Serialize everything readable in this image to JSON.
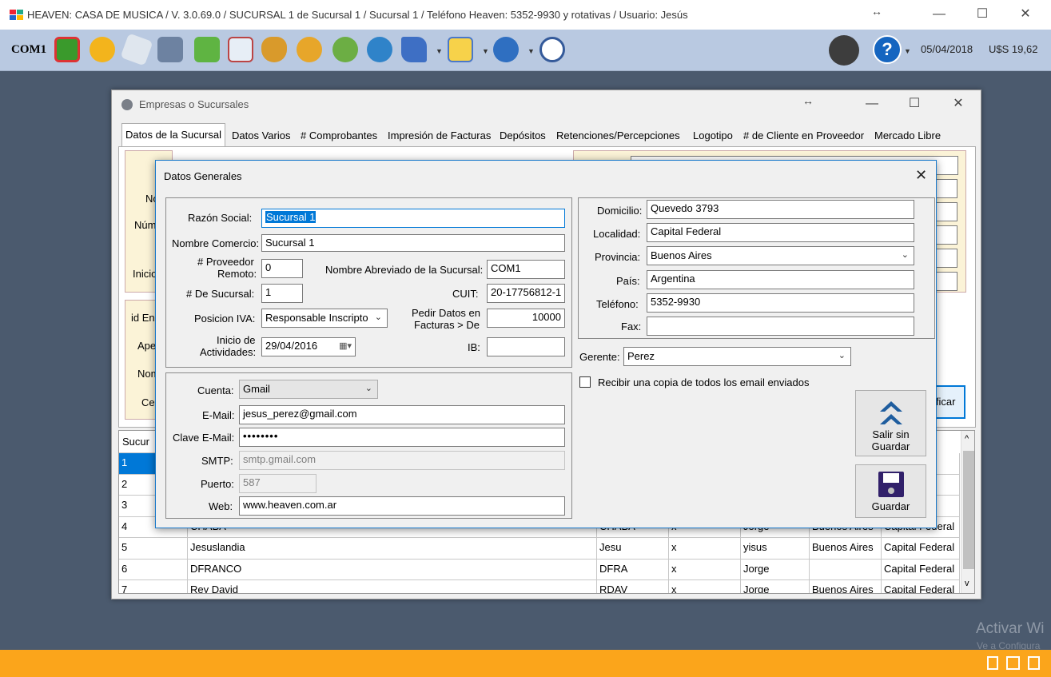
{
  "window": {
    "title": "HEAVEN: CASA DE MUSICA / V. 3.0.69.0 / SUCURSAL 1 de Sucursal 1 / Sucursal 1 / Teléfono Heaven: 5352-9930 y rotativas / Usuario: Jesús"
  },
  "toolbar": {
    "branch_code": "COM1",
    "date": "05/04/2018",
    "rate": "U$S 19,62"
  },
  "inner_window": {
    "title": "Empresas o Sucursales",
    "tabs": [
      "Datos de la Sucursal",
      "Datos Varios",
      "# Comprobantes",
      "Impresión de Facturas",
      "Depósitos",
      "Retenciones/Percepciones",
      "Logotipo",
      "# de Cliente en Proveedor",
      "Mercado Libre"
    ],
    "bg_labels": [
      "No",
      "Núm",
      "Inicio",
      "id En",
      "Ape",
      "Nom",
      "Cel"
    ],
    "bg_field_text": "Quevedo 3793",
    "modify_button": "ificar",
    "table": {
      "header": "Sucur",
      "rows": [
        {
          "n": "1",
          "name": "",
          "abbr": "",
          "x": "",
          "resp": "",
          "prov": "",
          "loc": "eral"
        },
        {
          "n": "2",
          "name": "",
          "abbr": "",
          "x": "",
          "resp": "",
          "prov": "",
          "loc": "eral"
        },
        {
          "n": "3",
          "name": "",
          "abbr": "",
          "x": "",
          "resp": "",
          "prov": "",
          "loc": "eral"
        },
        {
          "n": "4",
          "name": "CHABA",
          "abbr": "CHABA",
          "x": "x",
          "resp": "Jorge",
          "prov": "Buenos Aires",
          "loc": "Capital Federal"
        },
        {
          "n": "5",
          "name": "Jesuslandia",
          "abbr": "Jesu",
          "x": "x",
          "resp": "yisus",
          "prov": "Buenos Aires",
          "loc": "Capital Federal"
        },
        {
          "n": "6",
          "name": "DFRANCO",
          "abbr": "DFRA",
          "x": "x",
          "resp": "Jorge",
          "prov": "",
          "loc": "Capital Federal"
        },
        {
          "n": "7",
          "name": "Rey David",
          "abbr": "RDAV",
          "x": "x",
          "resp": "Jorge",
          "prov": "Buenos Aires",
          "loc": "Capital Federal"
        }
      ]
    }
  },
  "dialog": {
    "title": "Datos Generales",
    "razon_social": {
      "label": "Razón Social:",
      "value": "Sucursal 1"
    },
    "nombre_comercio": {
      "label": "Nombre Comercio:",
      "value": "Sucursal 1"
    },
    "proveedor_remoto": {
      "label1": "# Proveedor",
      "label2": "Remoto:",
      "value": "0"
    },
    "nombre_abreviado": {
      "label": "Nombre Abreviado de la Sucursal:",
      "value": "COM1"
    },
    "num_sucursal": {
      "label": "# De Sucursal:",
      "value": "1"
    },
    "cuit": {
      "label": "CUIT:",
      "value": "20-17756812-1"
    },
    "posicion_iva": {
      "label": "Posicion IVA:",
      "value": "Responsable Inscripto"
    },
    "pedir_datos": {
      "label1": "Pedir Datos en",
      "label2": "Facturas > De",
      "value": "10000"
    },
    "inicio_actividades": {
      "label1": "Inicio de",
      "label2": "Actividades:",
      "value": "29/04/2016"
    },
    "ib": {
      "label": "IB:",
      "value": ""
    },
    "cuenta": {
      "label": "Cuenta:",
      "value": "Gmail"
    },
    "email": {
      "label": "E-Mail:",
      "value": "jesus_perez@gmail.com"
    },
    "clave": {
      "label": "Clave E-Mail:",
      "value": "••••••••"
    },
    "smtp": {
      "label": "SMTP:",
      "value": "smtp.gmail.com"
    },
    "puerto": {
      "label": "Puerto:",
      "value": "587"
    },
    "web": {
      "label": "Web:",
      "value": "www.heaven.com.ar"
    },
    "domicilio": {
      "label": "Domicilio:",
      "value": "Quevedo 3793"
    },
    "localidad": {
      "label": "Localidad:",
      "value": "Capital Federal"
    },
    "provincia": {
      "label": "Provincia:",
      "value": "Buenos Aires"
    },
    "pais": {
      "label": "País:",
      "value": "Argentina"
    },
    "telefono": {
      "label": "Teléfono:",
      "value": "5352-9930"
    },
    "fax": {
      "label": "Fax:",
      "value": ""
    },
    "gerente": {
      "label": "Gerente:",
      "value": "Perez"
    },
    "copia_email": {
      "label": "Recibir una copia de todos los email enviados",
      "checked": false
    },
    "btn_salir": {
      "line1": "Salir sin",
      "line2": "Guardar"
    },
    "btn_guardar": "Guardar"
  },
  "watermark": {
    "line1": "Activar Wi",
    "line2": "Ve a Configura"
  },
  "colors": {
    "toolbar": "#b9c9e1",
    "desktop": "#4b5a6e",
    "taskbar": "#fba51b",
    "selection": "#0078d7",
    "accent": "#1979ca"
  }
}
